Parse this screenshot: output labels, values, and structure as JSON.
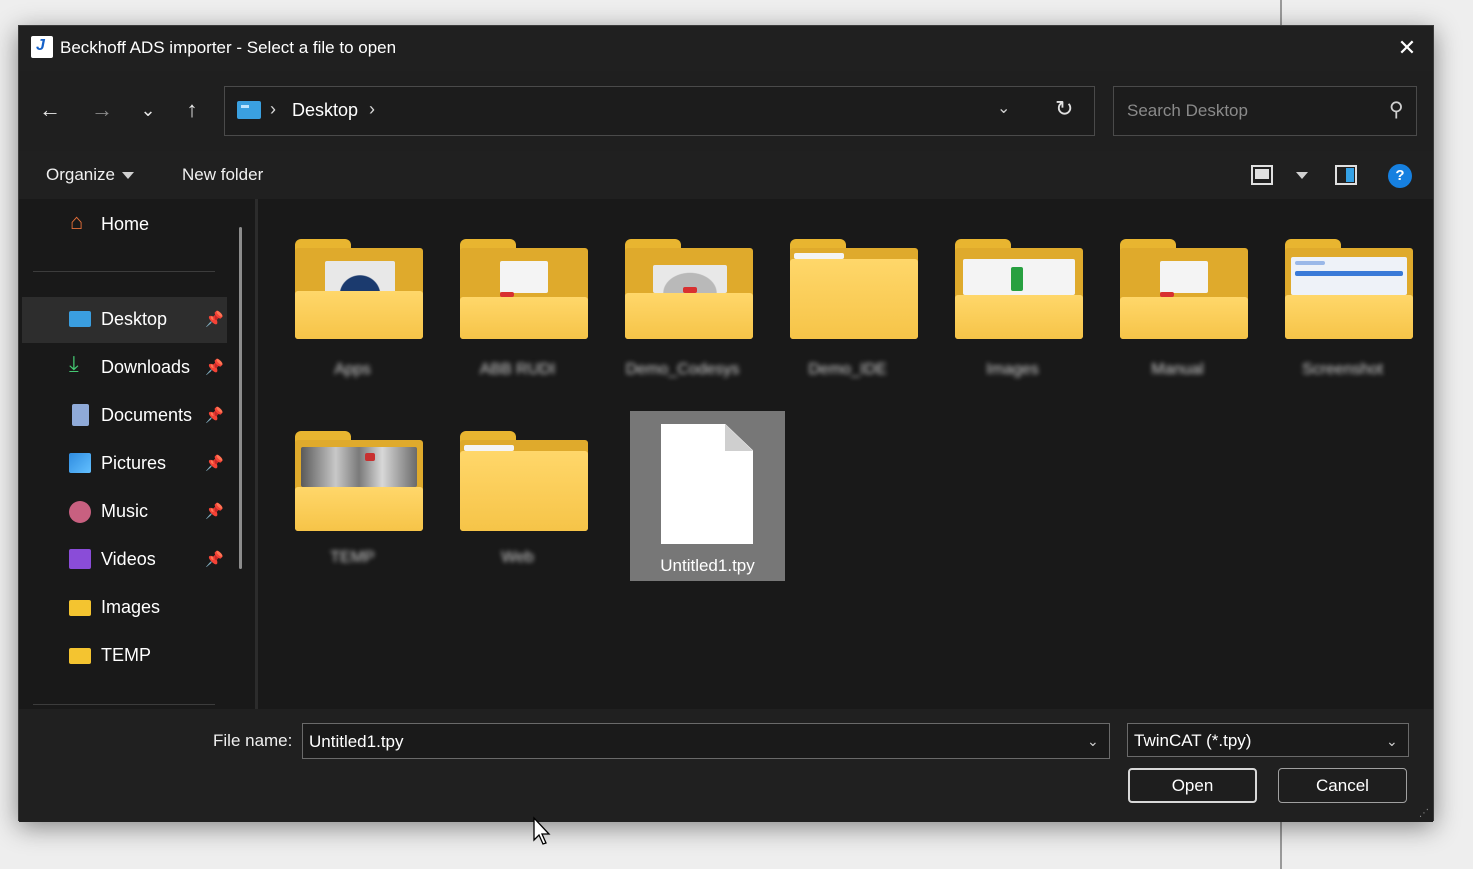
{
  "window": {
    "title": "Beckhoff ADS importer - Select a file to open",
    "app_icon_letter": "J"
  },
  "nav": {
    "back": "←",
    "forward": "→",
    "recent": "⌄",
    "up": "↑",
    "address": {
      "separator": "›",
      "crumbs": [
        "Desktop"
      ],
      "trailing_separator": "›",
      "dropdown": "⌄",
      "refresh": "↻"
    },
    "search_placeholder": "Search Desktop"
  },
  "commandbar": {
    "organize": "Organize",
    "new_folder": "New folder",
    "help": "?"
  },
  "sidebar": {
    "items": [
      {
        "label": "Home",
        "icon": "home-icon",
        "pinned": false
      },
      {
        "label": "Desktop",
        "icon": "desktop-icon",
        "pinned": true,
        "selected": true
      },
      {
        "label": "Downloads",
        "icon": "downloads-icon",
        "pinned": true
      },
      {
        "label": "Documents",
        "icon": "documents-icon",
        "pinned": true
      },
      {
        "label": "Pictures",
        "icon": "pictures-icon",
        "pinned": true
      },
      {
        "label": "Music",
        "icon": "music-icon",
        "pinned": true
      },
      {
        "label": "Videos",
        "icon": "videos-icon",
        "pinned": true
      },
      {
        "label": "Images",
        "icon": "folder-icon",
        "pinned": false
      },
      {
        "label": "TEMP",
        "icon": "folder-icon",
        "pinned": false
      }
    ],
    "pin_glyph": "📌"
  },
  "content": {
    "folders": [
      {
        "label": "Apps"
      },
      {
        "label": "ABB RUDI"
      },
      {
        "label": "Demo_Codesys"
      },
      {
        "label": "Demo_IDE"
      },
      {
        "label": "Images"
      },
      {
        "label": "Manual"
      },
      {
        "label": "Screenshot"
      },
      {
        "label": "TEMP"
      },
      {
        "label": "Web"
      }
    ],
    "file": {
      "label": "Untitled1.tpy",
      "selected": true
    }
  },
  "bottom": {
    "file_name_label": "File name:",
    "file_name_value": "Untitled1.tpy",
    "file_type_value": "TwinCAT (*.tpy)",
    "open_label": "Open",
    "cancel_label": "Cancel"
  },
  "colors": {
    "background": "#191919",
    "folder": "#f6c448",
    "accent": "#1680e0"
  }
}
